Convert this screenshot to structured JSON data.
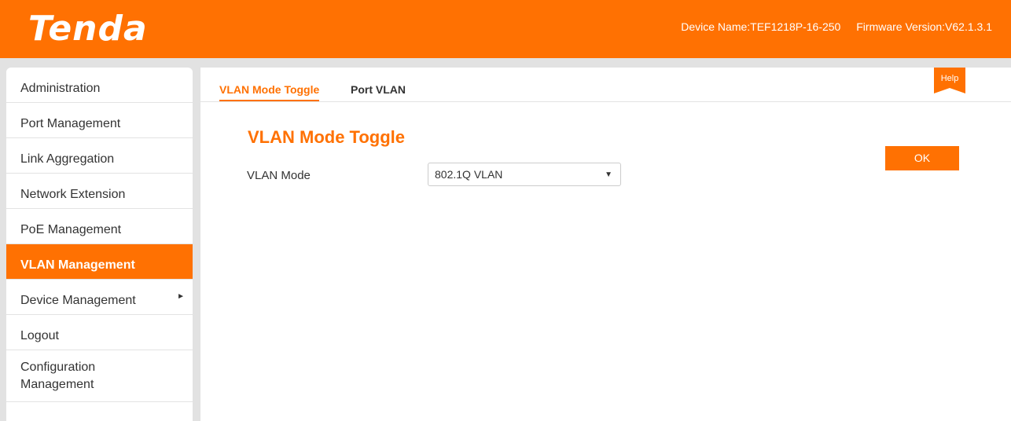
{
  "header": {
    "logo": "Tenda",
    "device_name": "Device Name:TEF1218P-16-250",
    "firmware_version": "Firmware Version:V62.1.3.1"
  },
  "sidebar": {
    "items": [
      {
        "label": "Administration"
      },
      {
        "label": "Port Management"
      },
      {
        "label": "Link Aggregation"
      },
      {
        "label": "Network Extension"
      },
      {
        "label": "PoE Management"
      },
      {
        "label": "VLAN Management",
        "active": true
      },
      {
        "label": "Device Management",
        "has_submenu": true
      },
      {
        "label": "Logout"
      },
      {
        "label": "Configuration Management"
      }
    ]
  },
  "tabs": [
    {
      "label": "VLAN Mode Toggle",
      "active": true
    },
    {
      "label": "Port VLAN"
    }
  ],
  "help": {
    "label": "Help"
  },
  "main": {
    "title": "VLAN Mode Toggle",
    "vlan_mode_label": "VLAN Mode",
    "vlan_mode_value": "802.1Q VLAN",
    "ok_label": "OK"
  },
  "colors": {
    "accent": "#ff7102",
    "background": "#e2e2e2"
  }
}
